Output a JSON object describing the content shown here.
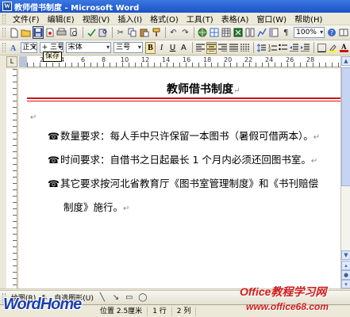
{
  "window": {
    "title": "教师借书制度 - Microsoft Word",
    "app_icon": "W"
  },
  "menu": {
    "items": [
      "文件(F)",
      "编辑(E)",
      "视图(V)",
      "插入(I)",
      "格式(O)",
      "工具(T)",
      "表格(A)",
      "窗口(W)",
      "帮助(H)"
    ]
  },
  "toolbar": {
    "zoom": "100%",
    "tooltip": "保存",
    "icons": [
      "new-doc-icon",
      "open-icon",
      "save-icon",
      "permission-icon",
      "print-icon",
      "print-preview-icon",
      "spelling-icon",
      "research-icon",
      "cut-icon",
      "copy-icon",
      "paste-icon",
      "format-painter-icon",
      "undo-icon",
      "redo-icon",
      "hyperlink-icon",
      "tables-borders-icon",
      "insert-table-icon",
      "excel-icon",
      "columns-icon",
      "drawing-icon",
      "document-map-icon",
      "show-hide-icon"
    ]
  },
  "format_toolbar": {
    "style": "正文",
    "style_size": "+ 三号",
    "font": "宋体",
    "size": "三号",
    "bold": "B",
    "italic": "I",
    "underline": "U",
    "char_border": "A",
    "font_color": "A"
  },
  "ruler": {
    "marks": [
      "2",
      "4",
      "6",
      "8",
      "10",
      "12",
      "14",
      "16",
      "18",
      "20",
      "22",
      "24",
      "26",
      "28"
    ]
  },
  "document": {
    "title": "教师借书制度",
    "paragraph_mark": "↵",
    "bullet": "☎",
    "paragraphs": [
      "数量要求：每人手中只许保留一本图书（暑假可借两本）。",
      "时间要求：自借书之日起最长 1 个月内必须还回图书室。",
      "其它要求按河北省教育厅《图书室管理制度》和《书刊赔偿",
      "制度》施行。"
    ]
  },
  "drawing_toolbar": {
    "draw_label": "绘图(R)",
    "autoshapes_label": "自选图形(U)"
  },
  "status": {
    "position": "位置 2.5厘米",
    "line": "1 行",
    "col": "2 列"
  },
  "watermark": {
    "left": "WordHome",
    "right_title": "Office教程学习网",
    "right_url": "www.office68.com"
  }
}
